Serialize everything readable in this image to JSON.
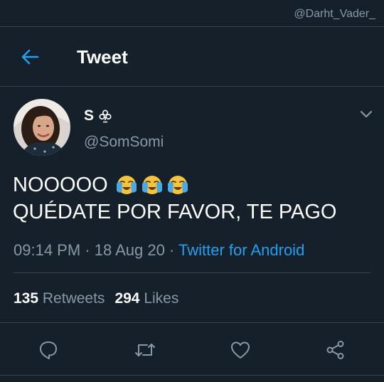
{
  "watermark": "@Darht_Vader_",
  "header": {
    "back_icon": "arrow-left-icon",
    "title": "Tweet"
  },
  "tweet": {
    "author": {
      "display_name": "S",
      "name_icon": "club-suit-icon",
      "handle": "@SomSomi",
      "avatar": "avatar"
    },
    "more_icon": "chevron-down-icon",
    "text_line1": "NOOOOO",
    "emojis": [
      "crying-face-emoji",
      "crying-face-emoji",
      "crying-face-emoji"
    ],
    "text_line2": "QUÉDATE POR FAVOR, TE PAGO",
    "time": "09:14 PM",
    "separator": " · ",
    "date": "18 Aug 20",
    "source": "Twitter for Android"
  },
  "stats": {
    "retweets_count": "135",
    "retweets_label": "Retweets",
    "likes_count": "294",
    "likes_label": "Likes"
  },
  "actions": [
    "reply-icon",
    "retweet-icon",
    "like-icon",
    "share-icon"
  ],
  "colors": {
    "background": "#15202b",
    "accent": "#1da1f2",
    "muted": "#8899a6",
    "divider": "#38444d"
  }
}
